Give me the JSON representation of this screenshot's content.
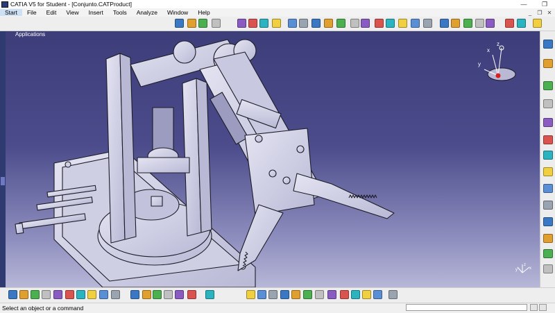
{
  "window": {
    "title": "CATIA V5 for Student - [Conjunto.CATProduct]",
    "minimize_glyph": "—",
    "restore_glyph": "❐",
    "close_glyph": "✕"
  },
  "menu": {
    "items": [
      "Start",
      "File",
      "Edit",
      "View",
      "Insert",
      "Tools",
      "Analyze",
      "Window",
      "Help"
    ],
    "active_index": 0
  },
  "viewport": {
    "tree_label": "Applications",
    "compass_axes": [
      "x",
      "y",
      "z"
    ],
    "axis_triad": [
      "x",
      "y",
      "z"
    ]
  },
  "status_bar": {
    "message": "Select an object or a command",
    "command_input_value": ""
  },
  "colors": {
    "background_top": "#3d3d7a",
    "background_bottom": "#b7b7d8",
    "part_fill": "#d6d6ea",
    "part_edge": "#1c1c28",
    "highlight_red": "#d82020"
  },
  "icons": {
    "toolbar_top": [
      "snapshot-icon",
      "select-icon",
      "undo-icon",
      "update-icon",
      "compass-icon",
      "assembly-icon",
      "product-icon",
      "component-icon",
      "part-icon",
      "existing-component-icon",
      "replace-icon",
      "graph-tree-icon",
      "reorder-icon",
      "multi-instantiation-icon",
      "constraint-icon",
      "coincidence-icon",
      "contact-icon",
      "offset-icon",
      "angle-icon",
      "fix-icon",
      "fix-together-icon",
      "quick-constraint-icon",
      "flexible-icon",
      "reuse-pattern-icon",
      "manipulation-icon",
      "snap-icon",
      "explode-icon",
      "clash-icon"
    ],
    "toolbar_bottom": [
      "new-icon",
      "open-icon",
      "save-icon",
      "print-icon",
      "cut-icon",
      "copy-icon",
      "paste-icon",
      "undo-icon",
      "redo-icon",
      "whats-this-icon",
      "formula-icon",
      "comment-icon",
      "catalog-icon",
      "table-icon",
      "knowledge-icon",
      "space-analysis-icon",
      "fly-icon",
      "pan-icon",
      "rotate-icon",
      "zoom-in-icon",
      "zoom-out-icon",
      "normal-view-icon",
      "iso-view-icon",
      "shading-icon",
      "hide-show-icon",
      "swap-icon",
      "measure-icon",
      "material-icon",
      "bill-of-material-icon",
      "render-icon"
    ],
    "toolbar_right": [
      "normal-icon",
      "select-arrow-icon",
      "sketcher-icon",
      "design-table-icon",
      "analyze-icon",
      "publish-icon",
      "scene-icon",
      "tolerance-icon",
      "sectioning-icon",
      "distance-icon",
      "annotation-icon",
      "weld-icon",
      "layout-icon",
      "catalog-browser-icon"
    ]
  }
}
